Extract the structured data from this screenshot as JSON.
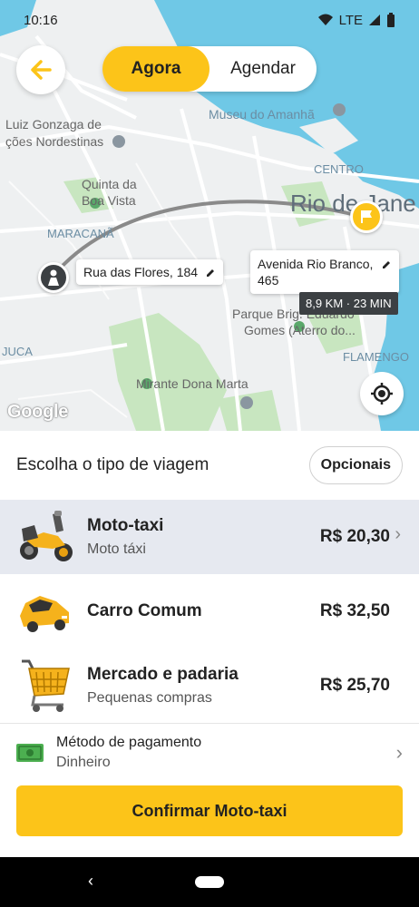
{
  "status_bar": {
    "time": "10:16",
    "network": "LTE"
  },
  "toggle": {
    "active": "Agora",
    "inactive": "Agendar"
  },
  "map": {
    "labels": {
      "museu": "Museu do Amanhã",
      "luiz1": "Luiz Gonzaga de",
      "luiz2": "ções Nordestinas",
      "centro": "CENTRO",
      "quinta1": "Quinta da",
      "quinta2": "Boa Vista",
      "rio": "Rio de Jane",
      "maracana": "MARACANÃ",
      "parque1": "Parque Brig. Eduardo",
      "parque2": "Gomes (Aterro do...",
      "flamengo": "FLAMENGO",
      "juca": "JUCA",
      "mirante": "Mirante Dona Marta",
      "google": "Google"
    },
    "origin_address": "Rua das Flores, 184",
    "destination_address_line1": "Avenida Rio Branco,",
    "destination_address_line2": "465",
    "distance_badge": "8,9 KM · 23 MIN"
  },
  "panel": {
    "title": "Escolha o tipo de viagem",
    "options_button": "Opcionais",
    "rides": [
      {
        "name": "Moto-taxi",
        "subtitle": "Moto táxi",
        "price": "R$ 20,30"
      },
      {
        "name": "Carro Comum",
        "subtitle": "",
        "price": "R$ 32,50"
      },
      {
        "name": "Mercado e padaria",
        "subtitle": "Pequenas compras",
        "price": "R$ 25,70"
      }
    ],
    "payment": {
      "label": "Método de pagamento",
      "value": "Dinheiro"
    },
    "confirm_button": "Confirmar  Moto-taxi"
  },
  "colors": {
    "accent": "#fcc419",
    "water": "#6fc8e6",
    "park": "#c8e6c0"
  }
}
